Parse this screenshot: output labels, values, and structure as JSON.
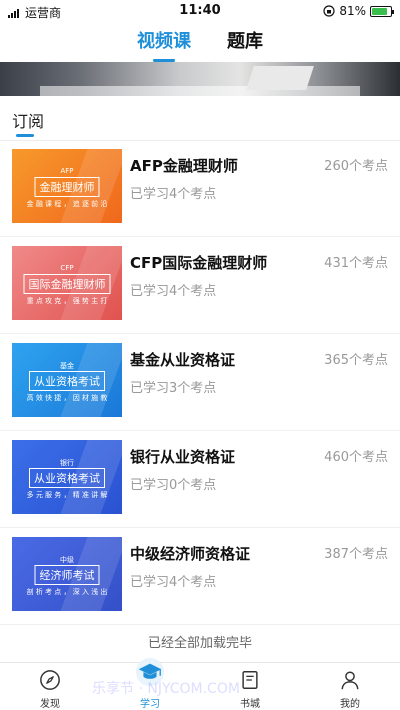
{
  "status_bar": {
    "carrier": "运营商",
    "time": "11:40",
    "battery": "81%"
  },
  "top_tabs": [
    {
      "label": "视频课",
      "active": true
    },
    {
      "label": "题库",
      "active": false
    }
  ],
  "section": {
    "title": "订阅"
  },
  "courses": [
    {
      "name": "AFP金融理财师",
      "progress": "已学习4个考点",
      "count": "260个考点",
      "thumb": {
        "top": "AFP",
        "box": "金融理财师",
        "sub": "金 融 课 程 ， 追 逐 前 沿",
        "color_a": "#f7992b",
        "color_b": "#f0681d"
      }
    },
    {
      "name": "CFP国际金融理财师",
      "progress": "已学习4个考点",
      "count": "431个考点",
      "thumb": {
        "top": "CFP",
        "box": "国际金融理财师",
        "sub": "重 点 攻 克 ， 强 势 主 打",
        "color_a": "#f08a8a",
        "color_b": "#e0524e"
      }
    },
    {
      "name": "基金从业资格证",
      "progress": "已学习3个考点",
      "count": "365个考点",
      "thumb": {
        "top": "基金",
        "box": "从业资格考试",
        "sub": "高 效 快 捷 ， 因 材 施 教",
        "color_a": "#2ea3ef",
        "color_b": "#1a78d8"
      }
    },
    {
      "name": "银行从业资格证",
      "progress": "已学习0个考点",
      "count": "460个考点",
      "thumb": {
        "top": "银行",
        "box": "从业资格考试",
        "sub": "多 元 服 务 ， 精 准 讲 解",
        "color_a": "#3b6fe8",
        "color_b": "#2a52d2"
      }
    },
    {
      "name": "中级经济师资格证",
      "progress": "已学习4个考点",
      "count": "387个考点",
      "thumb": {
        "top": "中级",
        "box": "经济师考试",
        "sub": "剖 析 考 点 ， 深 入 浅 出",
        "color_a": "#4a6be6",
        "color_b": "#3450c8"
      }
    }
  ],
  "load_done": "已经全部加载完毕",
  "bottom_nav": [
    {
      "label": "发现",
      "icon": "compass-icon",
      "active": false
    },
    {
      "label": "学习",
      "icon": "graduation-cap-icon",
      "active": true
    },
    {
      "label": "书城",
      "icon": "book-icon",
      "active": false
    },
    {
      "label": "我的",
      "icon": "user-icon",
      "active": false
    }
  ],
  "watermark": "乐享节 · NJYCOM.COM",
  "colors": {
    "accent": "#1e8fd8",
    "muted": "#999999"
  }
}
